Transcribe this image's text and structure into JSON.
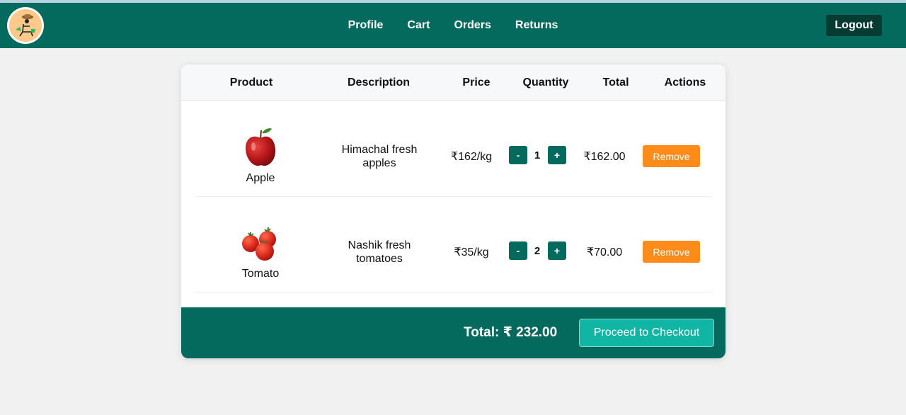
{
  "nav": {
    "links": [
      "Profile",
      "Cart",
      "Orders",
      "Returns"
    ],
    "logout_label": "Logout"
  },
  "table": {
    "headers": [
      "Product",
      "Description",
      "Price",
      "Quantity",
      "Total",
      "Actions"
    ],
    "rows": [
      {
        "name": "Apple",
        "image": "apple-image",
        "description": "Himachal fresh apples",
        "price": "₹162/kg",
        "quantity": "1",
        "total": "₹162.00",
        "action": "Remove"
      },
      {
        "name": "Tomato",
        "image": "tomato-image",
        "description": "Nashik fresh tomatoes",
        "price": "₹35/kg",
        "quantity": "2",
        "total": "₹70.00",
        "action": "Remove"
      }
    ]
  },
  "qty_controls": {
    "minus": "-",
    "plus": "+"
  },
  "footer": {
    "total_label": "Total: ₹ 232.00",
    "checkout_label": "Proceed to Checkout"
  },
  "colors": {
    "primary": "#046a5d",
    "remove": "#ff8c1a",
    "checkout": "#10b5a3"
  }
}
